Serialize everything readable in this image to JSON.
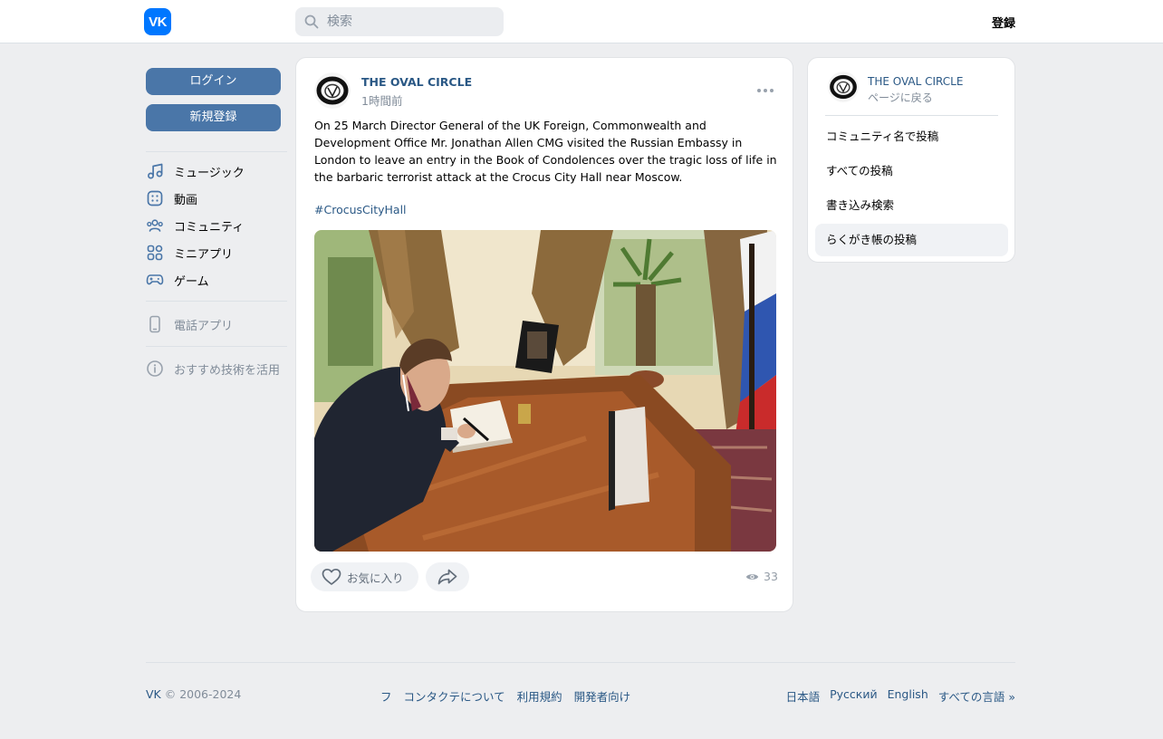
{
  "header": {
    "logo_text": "VK",
    "search_placeholder": "検索",
    "signup_label": "登録"
  },
  "left": {
    "login_label": "ログイン",
    "register_label": "新規登録",
    "menu": [
      {
        "label": "ミュージック",
        "icon": "music-icon"
      },
      {
        "label": "動画",
        "icon": "video-icon"
      },
      {
        "label": "コミュニティ",
        "icon": "community-icon"
      },
      {
        "label": "ミニアプリ",
        "icon": "mini-apps-icon"
      },
      {
        "label": "ゲーム",
        "icon": "gamepad-icon"
      }
    ],
    "phone_app_label": "電話アプリ",
    "recommend_label": "おすすめ技術を活用"
  },
  "post": {
    "author": "THE OVAL CIRCLE",
    "time": "1時間前",
    "text": "On 25 March Director General of the UK Foreign, Commonwealth and Development Office Mr. Jonathan Allen CMG visited the Russian Embassy in London to leave an entry in the Book of Condolences over the tragic loss of life in the barbaric terrorist attack at the Crocus City Hall near Moscow.",
    "hashtag": "#CrocusCityHall",
    "like_label": "お気に入り",
    "views": "33"
  },
  "right": {
    "title": "THE OVAL CIRCLE",
    "back_label": "ページに戻る",
    "items": [
      {
        "label": "コミュニティ名で投稿",
        "active": false
      },
      {
        "label": "すべての投稿",
        "active": false
      },
      {
        "label": "書き込み検索",
        "active": false
      },
      {
        "label": "らくがき帳の投稿",
        "active": true
      }
    ]
  },
  "footer": {
    "vk": "VK",
    "copyright": " © 2006-2024",
    "links": [
      "フ",
      "コンタクテについて",
      "利用規約",
      "開発者向け"
    ],
    "languages": [
      "日本語",
      "Русский",
      "English",
      "すべての言語 »"
    ]
  },
  "colors": {
    "accent": "#4a76a8",
    "link": "#2a5885",
    "brand": "#0077ff",
    "background": "#edeef0"
  }
}
